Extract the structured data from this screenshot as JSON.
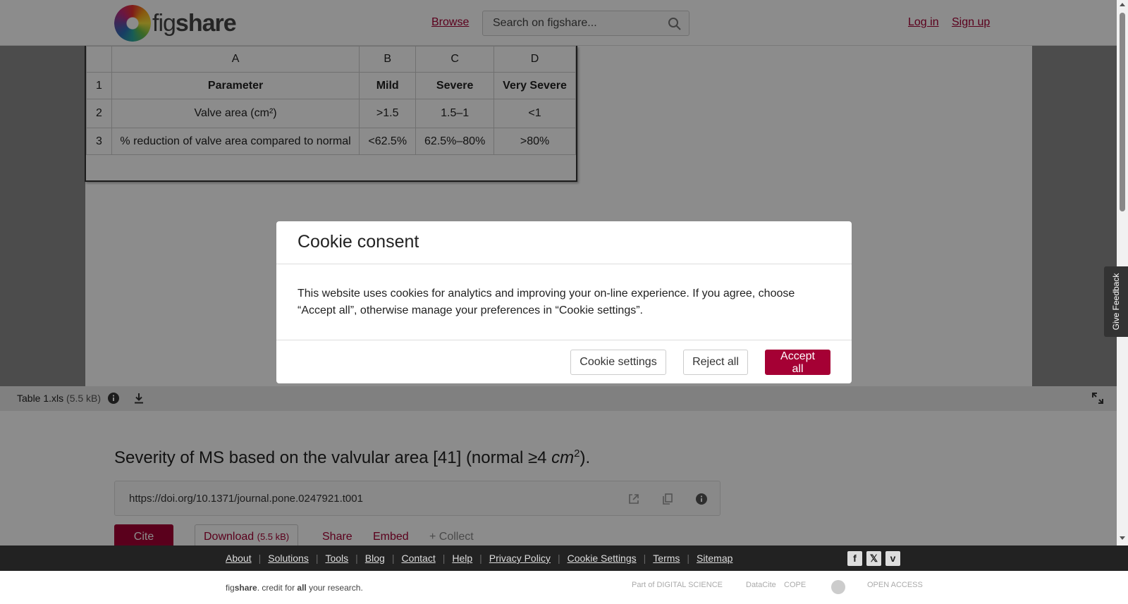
{
  "header": {
    "logo_text_a": "fig",
    "logo_text_b": "share",
    "browse": "Browse",
    "search_placeholder": "Search on figshare...",
    "login": "Log in",
    "signup": "Sign up"
  },
  "sheet": {
    "columns": [
      "A",
      "B",
      "C",
      "D"
    ],
    "rows": [
      {
        "num": "1",
        "cells": [
          "Parameter",
          "Mild",
          "Severe",
          "Very Severe"
        ]
      },
      {
        "num": "2",
        "cells": [
          "Valve area (cm²)",
          ">1.5",
          "1.5–1",
          "<1"
        ]
      },
      {
        "num": "3",
        "cells": [
          "% reduction of valve area compared to normal",
          "<62.5%",
          "62.5%–80%",
          ">80%"
        ]
      }
    ]
  },
  "viewer_bar": {
    "file_name": "Table 1.xls",
    "file_size": "(5.5 kB)"
  },
  "main": {
    "title_prefix": "Severity of MS based on the valvular area [41] (normal ≥4 ",
    "title_unit": "cm",
    "title_exp": "2",
    "title_suffix": ").",
    "doi": "https://doi.org/10.1371/journal.pone.0247921.t001",
    "cite": "Cite",
    "download": "Download",
    "download_size": "(5.5 kB)",
    "share": "Share",
    "embed": "Embed",
    "collect": "+ Collect"
  },
  "modal": {
    "title": "Cookie consent",
    "body": "This website uses cookies for analytics and improving your on-line experience. If you agree, choose “Accept all”, otherwise manage your preferences in “Cookie settings”.",
    "settings": "Cookie settings",
    "reject": "Reject all",
    "accept": "Accept all"
  },
  "feedback": "Give Feedback",
  "footer": {
    "links": [
      "About",
      "Solutions",
      "Tools",
      "Blog",
      "Contact",
      "Help",
      "Privacy Policy",
      "Cookie Settings",
      "Terms",
      "Sitemap"
    ],
    "credit_a": "fig",
    "credit_b": "share",
    "credit_c": ". credit for ",
    "credit_d": "all",
    "credit_e": " your research.",
    "partners": [
      "Part of DIGITAL SCIENCE",
      "DataCite",
      "COPE",
      "",
      "OPEN ACCESS"
    ]
  },
  "colors": {
    "brand": "#a50034"
  }
}
